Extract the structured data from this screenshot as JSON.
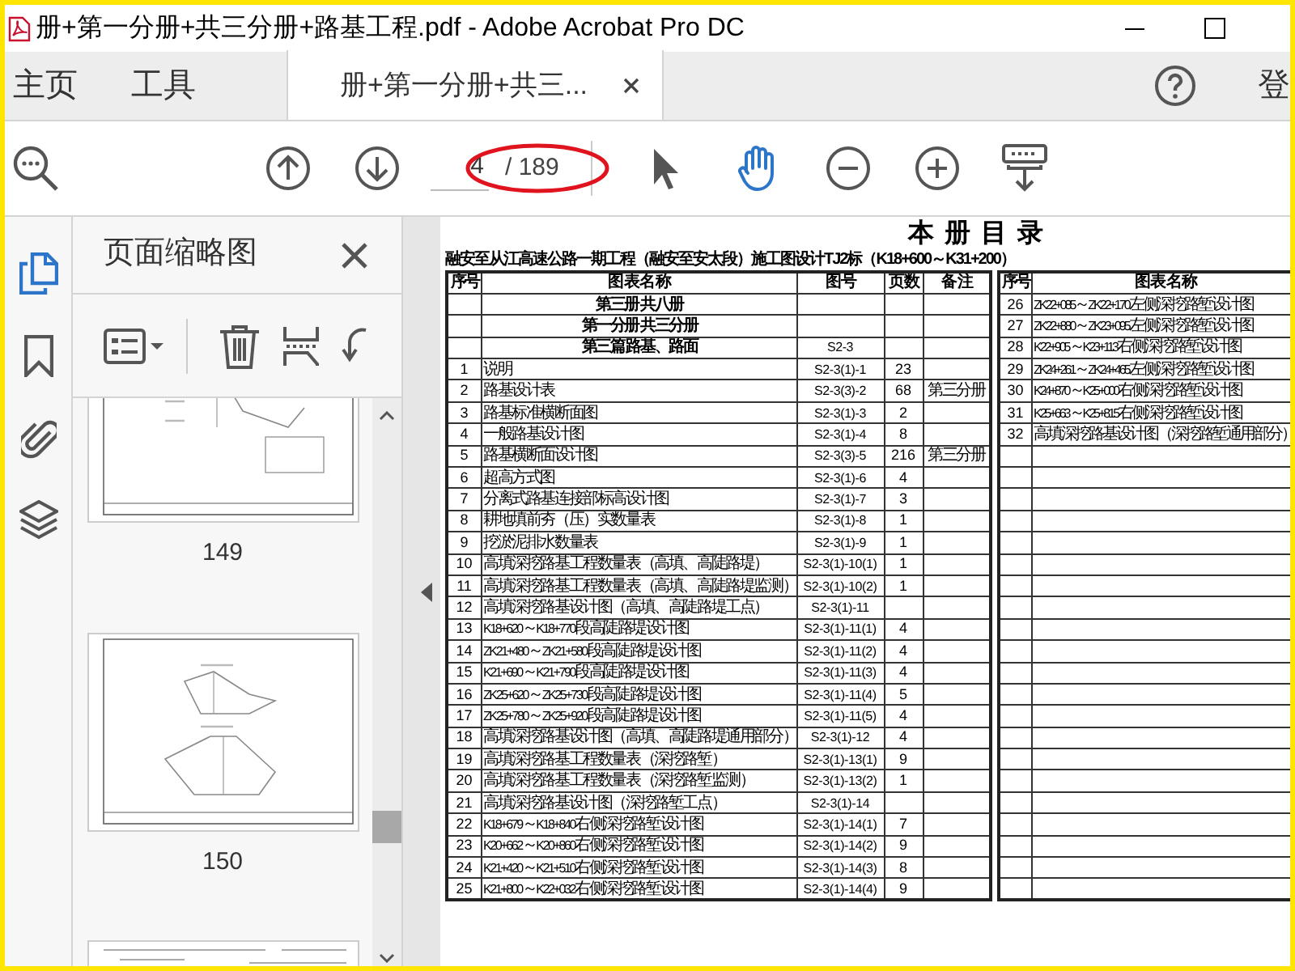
{
  "window": {
    "title": "册+第一分册+共三分册+路基工程.pdf - Adobe Acrobat Pro DC"
  },
  "tabs": [
    {
      "label": "主页",
      "selected": false
    },
    {
      "label": "工具",
      "selected": false
    },
    {
      "label": "册+第一分册+共三...",
      "selected": true
    }
  ],
  "sign_in": "登",
  "toolbar": {
    "page_current": "4",
    "page_total": "/ 189"
  },
  "rail": [
    {
      "kind": "pages",
      "selected": true
    },
    {
      "kind": "bookmarks",
      "selected": false
    },
    {
      "kind": "attachments",
      "selected": false
    },
    {
      "kind": "layers",
      "selected": false
    }
  ],
  "sidebar": {
    "title": "页面缩略图",
    "thumbnails": [
      {
        "label": "149"
      },
      {
        "label": "150"
      }
    ]
  },
  "document": {
    "title": "本 册 目 录",
    "subtitle": "融安至从江高速公路一期工程（融安至安太段）施工图设计TJ2标（K18+600～K31+200）",
    "table": {
      "columns": [
        "序号",
        "图 表 名 称",
        "图 号",
        "页 数",
        "备 注"
      ],
      "rows": [
        {
          "kind": "section",
          "name": "第三册  共八册"
        },
        {
          "kind": "section",
          "name": "第一分册  共三分册"
        },
        {
          "kind": "section",
          "name": "第三篇 路基、路面",
          "code": "S2-3"
        },
        {
          "kind": "item",
          "no": "1",
          "name": "说明",
          "code": "S2-3(1)-1",
          "pages": "23"
        },
        {
          "kind": "item",
          "no": "2",
          "name": "路基设计表",
          "code": "S2-3(3)-2",
          "pages": "68",
          "note": "第三分册"
        },
        {
          "kind": "item",
          "no": "3",
          "name": "路基标准横断面图",
          "code": "S2-3(1)-3",
          "pages": "2"
        },
        {
          "kind": "item",
          "no": "4",
          "name": "一般路基设计图",
          "code": "S2-3(1)-4",
          "pages": "8"
        },
        {
          "kind": "item",
          "no": "5",
          "name": "路基横断面设计图",
          "code": "S2-3(3)-5",
          "pages": "216",
          "note": "第三分册"
        },
        {
          "kind": "item",
          "no": "6",
          "name": "超高方式图",
          "code": "S2-3(1)-6",
          "pages": "4"
        },
        {
          "kind": "item",
          "no": "7",
          "name": "分离式路基连接部标高设计图",
          "code": "S2-3(1)-7",
          "pages": "3"
        },
        {
          "kind": "item",
          "no": "8",
          "name": "耕地填前夯（压）实数量表",
          "code": "S2-3(1)-8",
          "pages": "1"
        },
        {
          "kind": "item",
          "no": "9",
          "name": "挖淤泥排水数量表",
          "code": "S2-3(1)-9",
          "pages": "1"
        },
        {
          "kind": "item",
          "no": "10",
          "name": "高填深挖路基工程数量表（高填、高陡路堤）",
          "code": "S2-3(1)-10(1)",
          "pages": "1"
        },
        {
          "kind": "item",
          "no": "11",
          "name": "高填深挖路基工程数量表（高填、高陡路堤监测）",
          "code": "S2-3(1)-10(2)",
          "pages": "1"
        },
        {
          "kind": "item",
          "no": "12",
          "name": "高填深挖路基设计图（高填、高陡路堤工点）",
          "code": "S2-3(1)-11"
        },
        {
          "kind": "item",
          "no": "13",
          "name": "K18+620～K18+770段高陡路堤设计图",
          "code": "S2-3(1)-11(1)",
          "pages": "4"
        },
        {
          "kind": "item",
          "no": "14",
          "name": "ZK21+480～ZK21+580段高陡路堤设计图",
          "code": "S2-3(1)-11(2)",
          "pages": "4"
        },
        {
          "kind": "item",
          "no": "15",
          "name": "K21+690～K21+790段高陡路堤设计图",
          "code": "S2-3(1)-11(3)",
          "pages": "4"
        },
        {
          "kind": "item",
          "no": "16",
          "name": "ZK25+620～ZK25+730段高陡路堤设计图",
          "code": "S2-3(1)-11(4)",
          "pages": "5"
        },
        {
          "kind": "item",
          "no": "17",
          "name": "ZK25+780～ZK25+920段高陡路堤设计图",
          "code": "S2-3(1)-11(5)",
          "pages": "4"
        },
        {
          "kind": "item",
          "no": "18",
          "name": "高填深挖路基设计图（高填、高陡路堤通用部分）",
          "code": "S2-3(1)-12",
          "pages": "4"
        },
        {
          "kind": "item",
          "no": "19",
          "name": "高填深挖路基工程数量表（深挖路堑）",
          "code": "S2-3(1)-13(1)",
          "pages": "9"
        },
        {
          "kind": "item",
          "no": "20",
          "name": "高填深挖路基工程数量表（深挖路堑监测）",
          "code": "S2-3(1)-13(2)",
          "pages": "1"
        },
        {
          "kind": "item",
          "no": "21",
          "name": "高填深挖路基设计图（深挖路堑工点）",
          "code": "S2-3(1)-14"
        },
        {
          "kind": "item",
          "no": "22",
          "name": "K18+679～K18+840右侧深挖路堑设计图",
          "code": "S2-3(1)-14(1)",
          "pages": "7"
        },
        {
          "kind": "item",
          "no": "23",
          "name": "K20+662～K20+860右侧深挖路堑设计图",
          "code": "S2-3(1)-14(2)",
          "pages": "9"
        },
        {
          "kind": "item",
          "no": "24",
          "name": "K21+420～K21+510右侧深挖路堑设计图",
          "code": "S2-3(1)-14(3)",
          "pages": "8"
        },
        {
          "kind": "item",
          "no": "25",
          "name": "K21+800～K22+032右侧深挖路堑设计图",
          "code": "S2-3(1)-14(4)",
          "pages": "9"
        }
      ]
    },
    "table_2": {
      "columns": [
        "序号",
        "图 表 名 称"
      ],
      "rows": [
        {
          "no": "26",
          "name": "ZK22+085～ZK22+170左侧深挖路堑设计图"
        },
        {
          "no": "27",
          "name": "ZK22+880～ZK23+095左侧深挖路堑设计图"
        },
        {
          "no": "28",
          "name": "K22+905～K23+113右侧深挖路堑设计图"
        },
        {
          "no": "29",
          "name": "ZK24+261～ZK24+465左侧深挖路堑设计图"
        },
        {
          "no": "30",
          "name": "K24+870～K25+000右侧深挖路堑设计图"
        },
        {
          "no": "31",
          "name": "K25+663～K25+815右侧深挖路堑设计图"
        },
        {
          "no": "32",
          "name": "高填深挖路基设计图（深挖路堑通用部分）"
        }
      ]
    }
  }
}
